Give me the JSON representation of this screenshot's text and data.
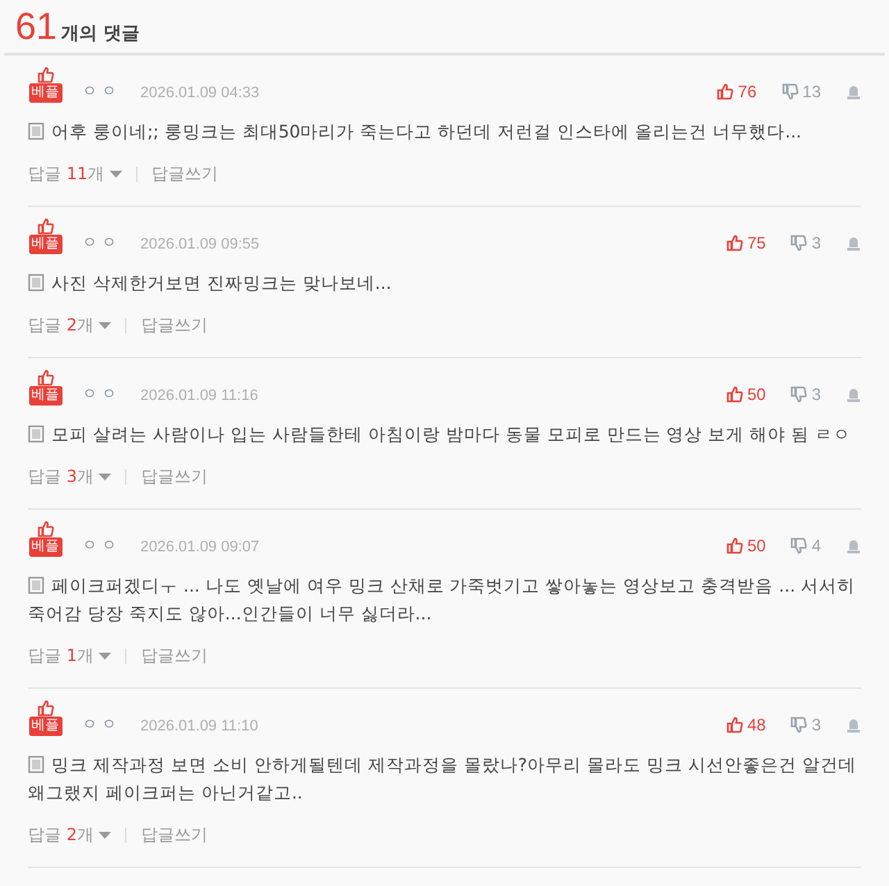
{
  "header": {
    "count": "61",
    "label": "개의 댓글"
  },
  "comments": [
    {
      "badge": "베플",
      "user": "ㅇㅇ",
      "date": "2026.01.09 04:33",
      "likes": "76",
      "dislikes": "13",
      "text": "어후 룽이네;; 룽밍크는 최대50마리가 죽는다고 하던데 저런걸 인스타에 올리는건 너무했다...",
      "reply_label": "답글",
      "reply_count": "11",
      "reply_unit": "개",
      "write_reply": "답글쓰기"
    },
    {
      "badge": "베플",
      "user": "ㅇㅇ",
      "date": "2026.01.09 09:55",
      "likes": "75",
      "dislikes": "3",
      "text": "사진 삭제한거보면 진짜밍크는 맞나보네...",
      "reply_label": "답글",
      "reply_count": "2",
      "reply_unit": "개",
      "write_reply": "답글쓰기"
    },
    {
      "badge": "베플",
      "user": "ㅇㅇ",
      "date": "2026.01.09 11:16",
      "likes": "50",
      "dislikes": "3",
      "text": "모피 살려는 사람이나 입는 사람들한테 아침이랑 밤마다 동물 모피로 만드는 영상 보게 해야 됨 ㄹㅇ",
      "reply_label": "답글",
      "reply_count": "3",
      "reply_unit": "개",
      "write_reply": "답글쓰기"
    },
    {
      "badge": "베플",
      "user": "ㅇㅇ",
      "date": "2026.01.09 09:07",
      "likes": "50",
      "dislikes": "4",
      "text": "페이크퍼겠디ㅜ ... 나도 옛날에 여우 밍크 산채로 가죽벗기고 쌓아놓는 영상보고 충격받음 ... 서서히 죽어감 당장 죽지도 않아...인간들이 너무 싫더라...",
      "reply_label": "답글",
      "reply_count": "1",
      "reply_unit": "개",
      "write_reply": "답글쓰기"
    },
    {
      "badge": "베플",
      "user": "ㅇㅇ",
      "date": "2026.01.09 11:10",
      "likes": "48",
      "dislikes": "3",
      "text": "밍크 제작과정 보면 소비 안하게될텐데 제작과정을 몰랐나?아무리 몰라도 밍크 시선안좋은건 알건데 왜그랬지 페이크퍼는 아닌거같고..",
      "reply_label": "답글",
      "reply_count": "2",
      "reply_unit": "개",
      "write_reply": "답글쓰기"
    }
  ]
}
